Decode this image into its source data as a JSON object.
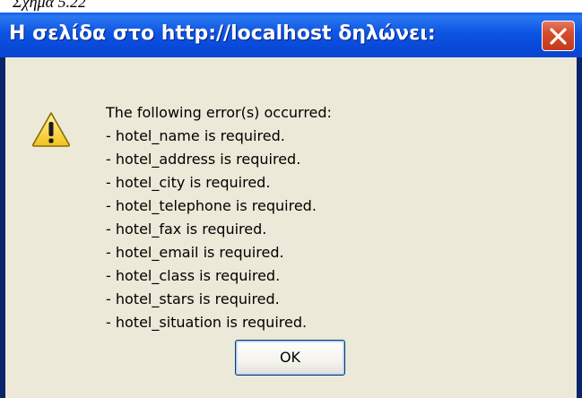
{
  "caption": "Σχήμα 5.22",
  "dialog": {
    "title": "Η σελίδα στο http://localhost δηλώνει:",
    "close_icon": "close-icon",
    "warning_icon": "warning-icon",
    "message_lines": [
      "The following error(s) occurred:",
      "- hotel_name is required.",
      "- hotel_address is required.",
      "- hotel_city is required.",
      "- hotel_telephone is required.",
      "- hotel_fax is required.",
      "- hotel_email is required.",
      "- hotel_class is required.",
      "- hotel_stars is required.",
      "- hotel_situation is required."
    ],
    "ok_label": "OK"
  },
  "colors": {
    "titlebar": "#0a5cf5",
    "client_bg": "#ece9d8",
    "close_button": "#d74c2c",
    "warning_fill": "#f8d12f"
  }
}
